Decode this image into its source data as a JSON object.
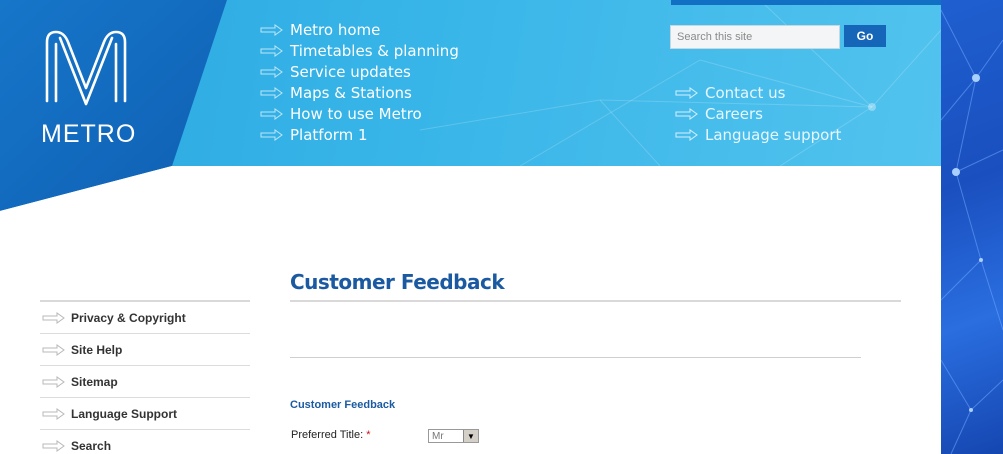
{
  "brand": {
    "wordmark": "METRO"
  },
  "header": {
    "main_nav": [
      {
        "label": "Metro home"
      },
      {
        "label": "Timetables & planning"
      },
      {
        "label": "Service updates"
      },
      {
        "label": "Maps & Stations"
      },
      {
        "label": "How to use Metro"
      },
      {
        "label": "Platform 1"
      }
    ],
    "utility_nav": [
      {
        "label": "Contact us"
      },
      {
        "label": "Careers"
      },
      {
        "label": "Language support"
      }
    ],
    "search": {
      "placeholder": "Search this site",
      "button_label": "Go"
    }
  },
  "sidebar": {
    "items": [
      {
        "label": "Privacy & Copyright"
      },
      {
        "label": "Site Help"
      },
      {
        "label": "Sitemap"
      },
      {
        "label": "Language Support"
      },
      {
        "label": "Search"
      }
    ]
  },
  "main": {
    "page_title": "Customer Feedback",
    "form": {
      "heading": "Customer Feedback",
      "preferred_title": {
        "label": "Preferred Title:",
        "required_mark": "*",
        "value": "Mr"
      }
    }
  },
  "colors": {
    "brand_blue": "#1566b8",
    "header_cyan": "#38b5e8",
    "title_blue": "#1b5aa0"
  },
  "icons": {
    "nav_arrow": "arrow-right-outline-icon",
    "select_toggle": "chevron-down-icon"
  }
}
